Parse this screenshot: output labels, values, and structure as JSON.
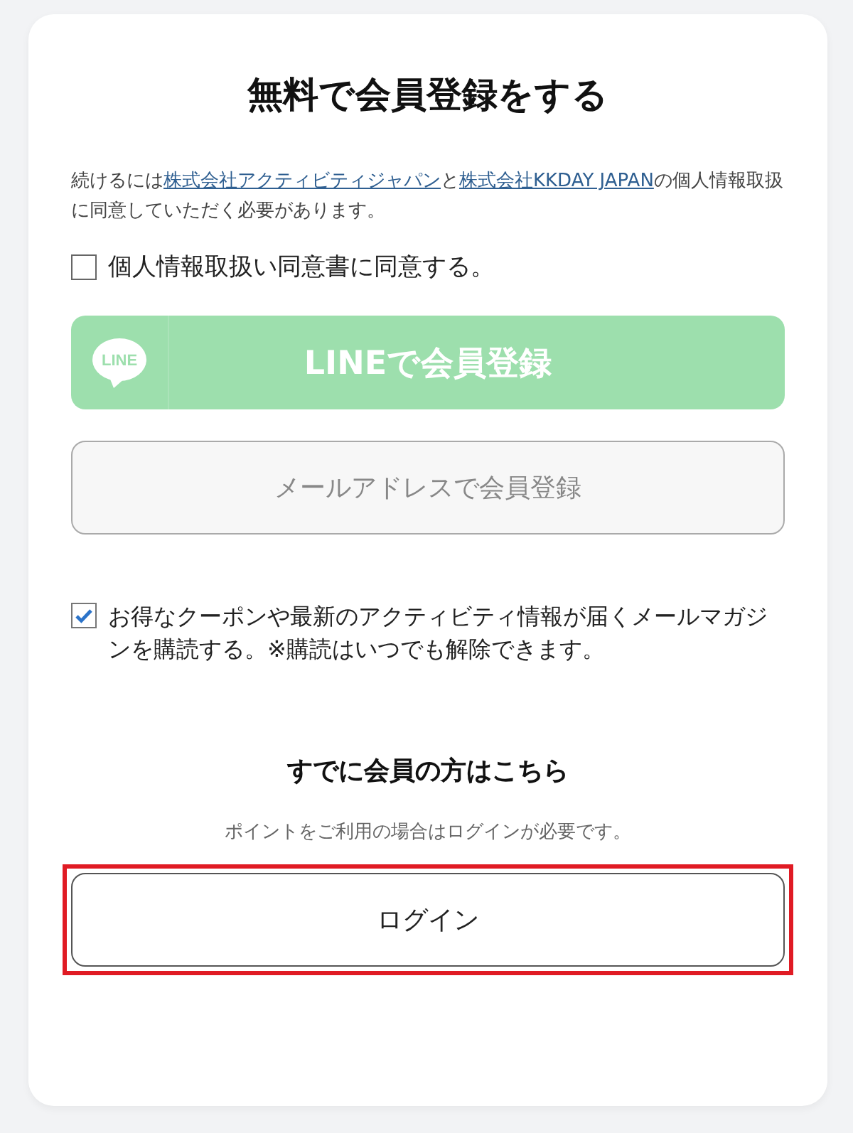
{
  "title": "無料で会員登録をする",
  "intro": [
    {
      "kind": "text",
      "text": "続けるには"
    },
    {
      "kind": "link",
      "text": "株式会社アクティビティジャパン"
    },
    {
      "kind": "text",
      "text": "と"
    },
    {
      "kind": "link",
      "text": "株式会社KKDAY JAPAN"
    },
    {
      "kind": "text",
      "text": "の個人情報取扱に同意していただく必要があります。"
    }
  ],
  "consent": {
    "label": "個人情報取扱い同意書に同意する。",
    "checked": false
  },
  "signup_buttons": [
    {
      "kind": "line",
      "logo_text": "LINE",
      "label": "LINEで会員登録",
      "disabled": true
    },
    {
      "kind": "email",
      "label": "メールアドレスで会員登録",
      "disabled": true
    }
  ],
  "newsletter": {
    "label": "お得なクーポンや最新のアクティビティ情報が届くメールマガジンを購読する。※購読はいつでも解除できます。",
    "checked": true
  },
  "member_section": {
    "heading": "すでに会員の方はこちら",
    "note": "ポイントをご利用の場合はログインが必要です。",
    "button": {
      "label": "ログイン",
      "highlighted": true
    }
  }
}
